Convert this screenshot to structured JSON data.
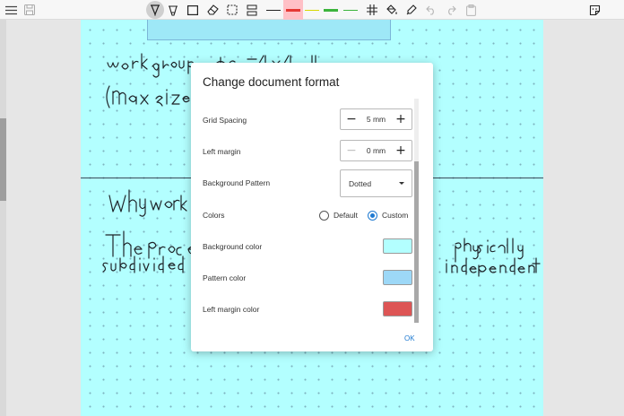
{
  "toolbar": {
    "icons": [
      "menu-icon",
      "save-icon",
      "pen-icon",
      "highlighter-icon",
      "rectangle-icon",
      "eraser-icon",
      "selection-icon",
      "insert-space-icon",
      "thin-black-stroke",
      "red-stroke",
      "yellow-stroke",
      "green-stroke",
      "thin-green-stroke",
      "grid-icon",
      "fill-icon",
      "marker-icon",
      "undo-icon",
      "redo-icon",
      "paste-icon",
      "sticker-icon"
    ],
    "stroke_colors": {
      "black": "#222222",
      "red": "#e53935",
      "yellow": "#e0e000",
      "green": "#3cb43c"
    }
  },
  "page": {
    "background_color": "#b3ffff",
    "pattern_dot_color": "#7fb3bf",
    "divider_color": "#3b4b5a"
  },
  "dialog": {
    "title": "Change document format",
    "grid_spacing": {
      "label": "Grid Spacing",
      "value": "5 mm"
    },
    "left_margin": {
      "label": "Left margin",
      "value": "0 mm"
    },
    "background_pattern": {
      "label": "Background Pattern",
      "value": "Dotted"
    },
    "colors": {
      "label": "Colors",
      "option_default": "Default",
      "option_custom": "Custom",
      "selected": "Custom"
    },
    "background_color": {
      "label": "Background color",
      "color": "#b3ffff"
    },
    "pattern_color": {
      "label": "Pattern color",
      "color": "#9dd8f7"
    },
    "left_margin_color": {
      "label": "Left margin color",
      "color": "#dd5555"
    },
    "ok_label": "OK"
  },
  "colors": {
    "accent": "#1f7ad1"
  }
}
